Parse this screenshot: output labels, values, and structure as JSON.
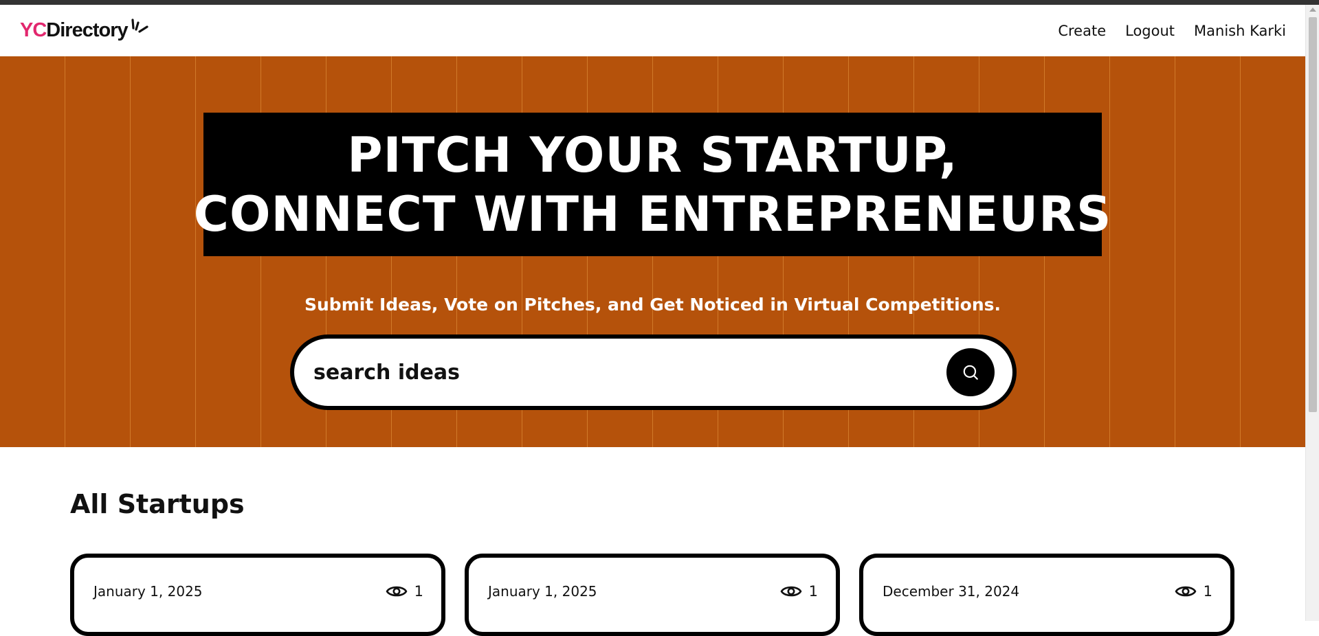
{
  "navbar": {
    "logo": {
      "part1": "YC",
      "part2": "Directory"
    },
    "links": [
      {
        "label": "Create"
      },
      {
        "label": "Logout"
      },
      {
        "label": "Manish Karki"
      }
    ]
  },
  "hero": {
    "headline_line1": "PITCH YOUR STARTUP,",
    "headline_line2": "CONNECT WITH ENTREPRENEURS",
    "subtitle": "Submit Ideas, Vote on Pitches, and Get Noticed in Virtual Competitions.",
    "search": {
      "placeholder": "search ideas",
      "value": ""
    }
  },
  "startups": {
    "title": "All Startups",
    "cards": [
      {
        "date": "January 1, 2025",
        "views": "1"
      },
      {
        "date": "January 1, 2025",
        "views": "1"
      },
      {
        "date": "December 31, 2024",
        "views": "1"
      }
    ]
  },
  "colors": {
    "accent_pink": "#e2276e",
    "hero_bg": "#b5520b",
    "black": "#000000"
  },
  "icons": {
    "search": "search-icon",
    "views": "eye-icon",
    "logo_spark": "spark-icon"
  }
}
